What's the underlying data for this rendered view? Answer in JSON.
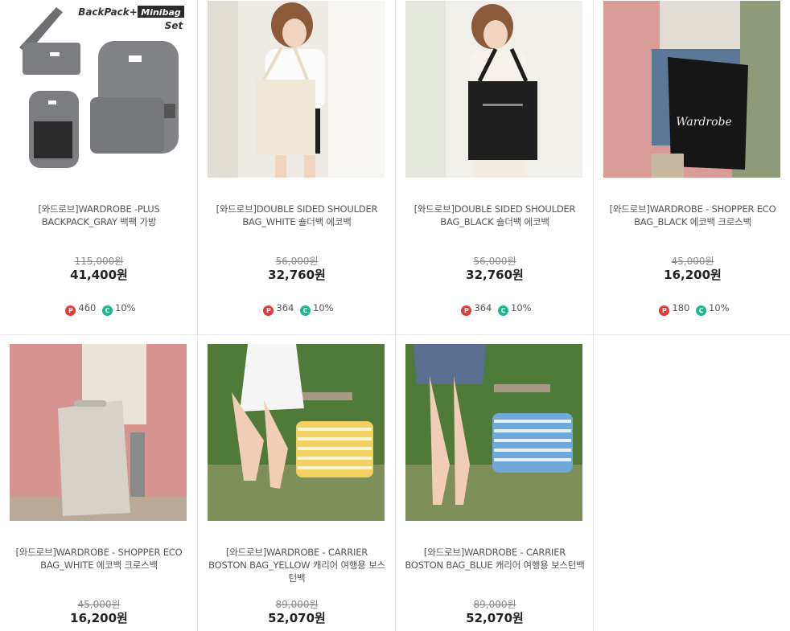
{
  "products": [
    {
      "name": "[와드로브]WARDROBE -PLUS BACKPACK_GRAY 백팩 가방",
      "old_price": "115,000원",
      "price": "41,400원",
      "points": "460",
      "discount": "10%",
      "image_text_1": "BackPack+",
      "image_text_2": "Minibag",
      "image_text_3": "Set"
    },
    {
      "name": "[와드로브]DOUBLE SIDED SHOULDER BAG_WHITE 숄더백 에코백",
      "old_price": "56,000원",
      "price": "32,760원",
      "points": "364",
      "discount": "10%"
    },
    {
      "name": "[와드로브]DOUBLE SIDED SHOULDER BAG_BLACK 숄더백 에코백",
      "old_price": "56,000원",
      "price": "32,760원",
      "points": "364",
      "discount": "10%"
    },
    {
      "name": "[와드로브]WARDROBE - SHOPPER ECO BAG_BLACK 에코백 크로스백",
      "old_price": "45,000원",
      "price": "16,200원",
      "points": "180",
      "discount": "10%"
    },
    {
      "name": "[와드로브]WARDROBE - SHOPPER ECO BAG_WHITE 에코백 크로스백",
      "old_price": "45,000원",
      "price": "16,200원"
    },
    {
      "name": "[와드로브]WARDROBE - CARRIER BOSTON BAG_YELLOW 캐리어 여행용 보스턴백",
      "old_price": "89,000원",
      "price": "52,070원"
    },
    {
      "name": "[와드로브]WARDROBE - CARRIER BOSTON BAG_BLUE 캐리어 여행용 보스턴백",
      "old_price": "89,000원",
      "price": "52,070원"
    }
  ],
  "badge_labels": {
    "point": "P",
    "coupon": "C"
  },
  "colors": {
    "point_badge": "#e53935",
    "coupon_badge": "#1bb88f",
    "border": "#e8e8e8"
  }
}
